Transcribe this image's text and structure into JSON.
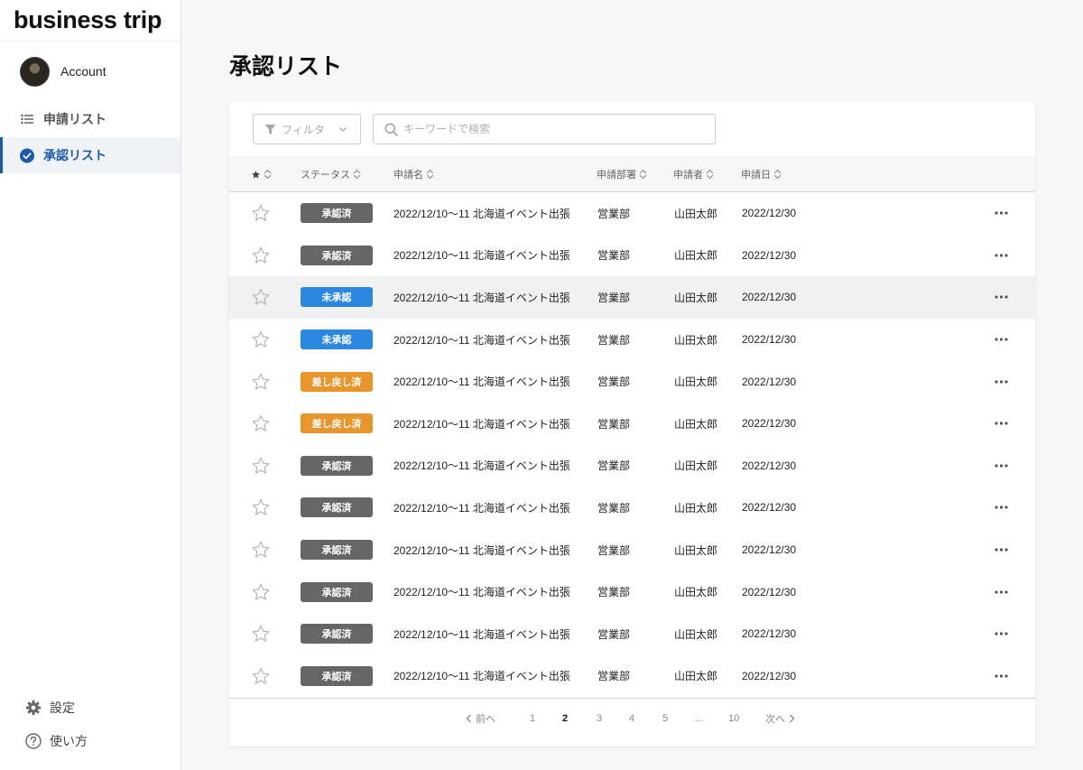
{
  "app": {
    "brand": "business trip"
  },
  "sidebar": {
    "account_label": "Account",
    "items": [
      {
        "label": "申請リスト",
        "icon": "list-icon",
        "active": false
      },
      {
        "label": "承認リスト",
        "icon": "check-circle-icon",
        "active": true
      }
    ],
    "bottom": [
      {
        "label": "設定",
        "icon": "gear-icon"
      },
      {
        "label": "使い方",
        "icon": "help-icon"
      }
    ]
  },
  "main": {
    "title": "承認リスト",
    "filter_label": "フィルタ",
    "search": {
      "placeholder": "キーワードで検索",
      "value": ""
    },
    "columns": {
      "status": "ステータス",
      "name": "申請名",
      "department": "申請部署",
      "applicant": "申請者",
      "date": "申請日"
    },
    "rows": [
      {
        "status": "承認済",
        "status_type": "approved",
        "name": "2022/12/10〜11 北海道イベント出張",
        "department": "営業部",
        "applicant": "山田太郎",
        "date": "2022/12/30",
        "highlight": false
      },
      {
        "status": "承認済",
        "status_type": "approved",
        "name": "2022/12/10〜11 北海道イベント出張",
        "department": "営業部",
        "applicant": "山田太郎",
        "date": "2022/12/30",
        "highlight": false
      },
      {
        "status": "未承認",
        "status_type": "pending",
        "name": "2022/12/10〜11 北海道イベント出張",
        "department": "営業部",
        "applicant": "山田太郎",
        "date": "2022/12/30",
        "highlight": true
      },
      {
        "status": "未承認",
        "status_type": "pending",
        "name": "2022/12/10〜11 北海道イベント出張",
        "department": "営業部",
        "applicant": "山田太郎",
        "date": "2022/12/30",
        "highlight": false
      },
      {
        "status": "差し戻し済",
        "status_type": "returned",
        "name": "2022/12/10〜11 北海道イベント出張",
        "department": "営業部",
        "applicant": "山田太郎",
        "date": "2022/12/30",
        "highlight": false
      },
      {
        "status": "差し戻し済",
        "status_type": "returned",
        "name": "2022/12/10〜11 北海道イベント出張",
        "department": "営業部",
        "applicant": "山田太郎",
        "date": "2022/12/30",
        "highlight": false
      },
      {
        "status": "承認済",
        "status_type": "approved",
        "name": "2022/12/10〜11 北海道イベント出張",
        "department": "営業部",
        "applicant": "山田太郎",
        "date": "2022/12/30",
        "highlight": false
      },
      {
        "status": "承認済",
        "status_type": "approved",
        "name": "2022/12/10〜11 北海道イベント出張",
        "department": "営業部",
        "applicant": "山田太郎",
        "date": "2022/12/30",
        "highlight": false
      },
      {
        "status": "承認済",
        "status_type": "approved",
        "name": "2022/12/10〜11 北海道イベント出張",
        "department": "営業部",
        "applicant": "山田太郎",
        "date": "2022/12/30",
        "highlight": false
      },
      {
        "status": "承認済",
        "status_type": "approved",
        "name": "2022/12/10〜11 北海道イベント出張",
        "department": "営業部",
        "applicant": "山田太郎",
        "date": "2022/12/30",
        "highlight": false
      },
      {
        "status": "承認済",
        "status_type": "approved",
        "name": "2022/12/10〜11 北海道イベント出張",
        "department": "営業部",
        "applicant": "山田太郎",
        "date": "2022/12/30",
        "highlight": false
      },
      {
        "status": "承認済",
        "status_type": "approved",
        "name": "2022/12/10〜11 北海道イベント出張",
        "department": "営業部",
        "applicant": "山田太郎",
        "date": "2022/12/30",
        "highlight": false
      }
    ],
    "status_colors": {
      "approved": "#666666",
      "pending": "#2b87e0",
      "returned": "#e8952b"
    },
    "pagination": {
      "prev": "前へ",
      "next": "次へ",
      "pages": [
        "1",
        "2",
        "3",
        "4",
        "5",
        "...",
        "10"
      ],
      "current": "2"
    }
  }
}
